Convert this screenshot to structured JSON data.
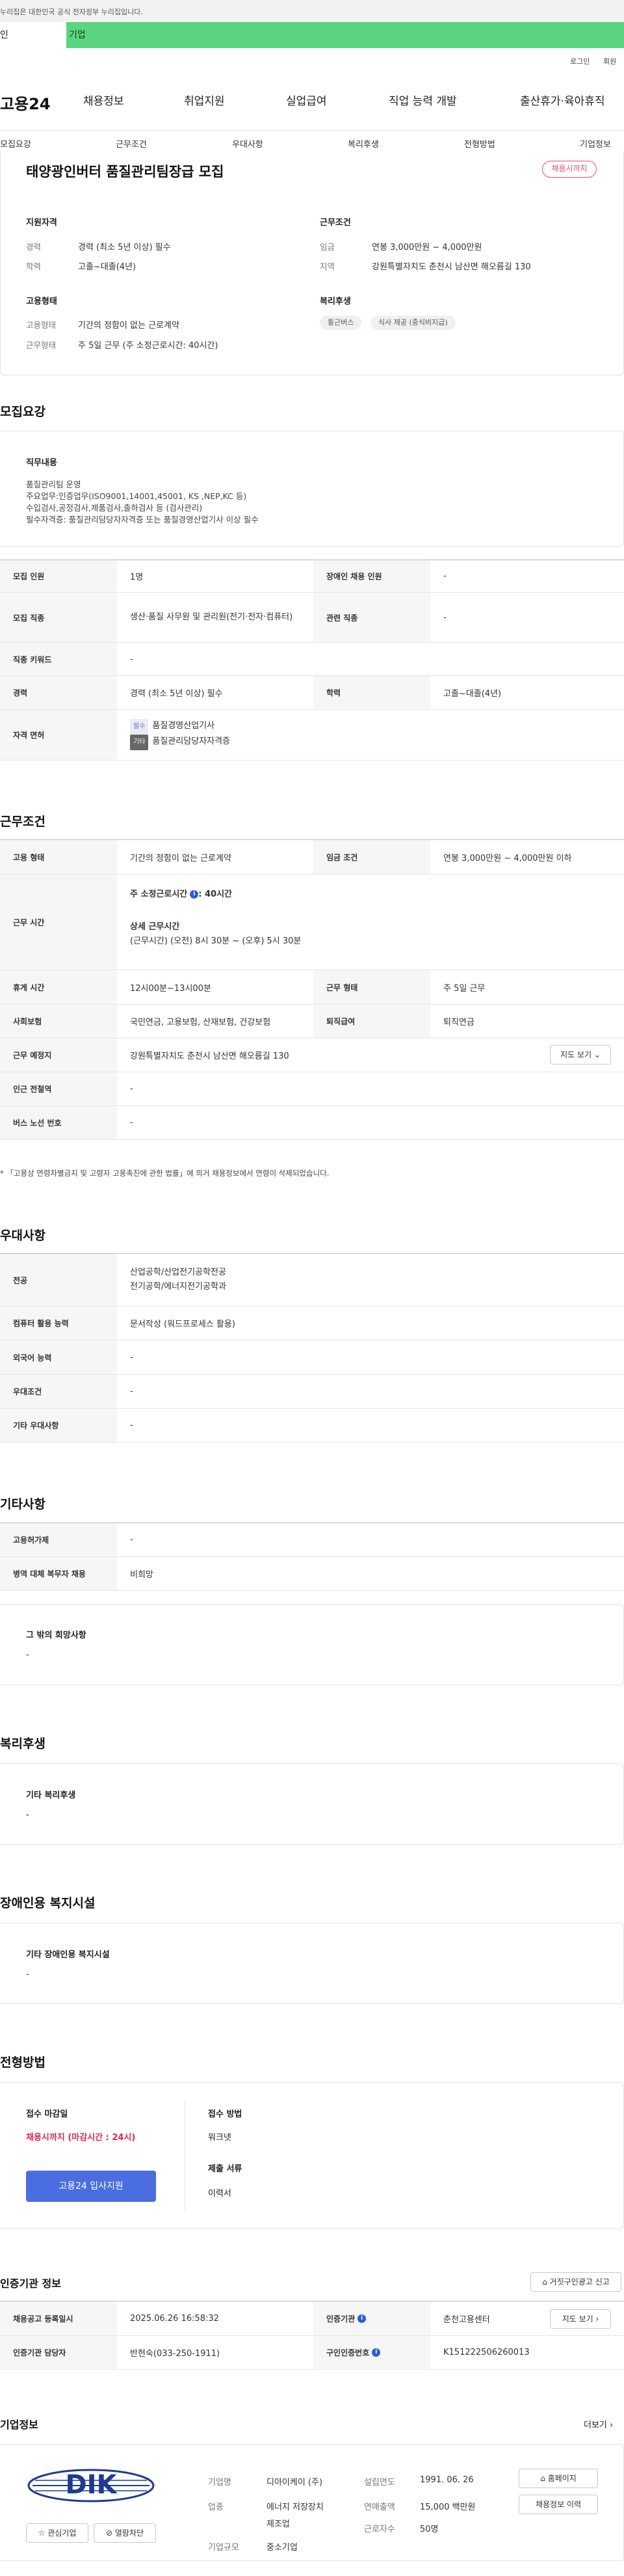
{
  "gov_notice": "누리집은 대한민국 공식 전자정부 누리집입니다.",
  "type_tabs": {
    "personal": "인",
    "company": "기업"
  },
  "util": {
    "login": "로그인",
    "signup": "회원"
  },
  "gnb": {
    "logo": "고용24",
    "items": [
      "채용정보",
      "취업지원",
      "실업급여",
      "직업 능력 개발",
      "출산휴가·육아휴직"
    ]
  },
  "subnav": [
    "모집요강",
    "근무조건",
    "우대사항",
    "복리후생",
    "전형방법",
    "기업정보"
  ],
  "summary": {
    "title": "태양광인버터 품질관리팀장급 모집",
    "status_pill": "채용시까지",
    "qual_head": "지원자격",
    "qual": [
      {
        "k": "경력",
        "v": "경력 (최소 5년 이상) 필수"
      },
      {
        "k": "학력",
        "v": "고졸~대졸(4년)"
      }
    ],
    "cond_head": "근무조건",
    "cond": [
      {
        "k": "임금",
        "v": "연봉 3,000만원 ~ 4,000만원"
      },
      {
        "k": "지역",
        "v": "강원특별자치도 춘천시 남산면 해오름길 130"
      }
    ],
    "emp_head": "고용형태",
    "emp": [
      {
        "k": "고용형태",
        "v": "기간의 정함이 없는 근로계약"
      },
      {
        "k": "근무형태",
        "v": "주 5일 근무 (주 소정근로시간: 40시간)"
      }
    ],
    "welfare_head": "복리후생",
    "welfare_tags": [
      "통근버스",
      "식사 제공 (중식비지급)"
    ]
  },
  "recruit": {
    "title": "모집요강",
    "duty_head": "직무내용",
    "duty_lines": [
      "품질관리팀 운영",
      "주요업무:인증업무(ISO9001,14001,45001, KS ,NEP,KC 등)",
      "수입검사,공정검사,제품검사,출하검사 등 (검사관리)",
      "필수자격증: 품질관리담당자자격증 또는 품질경영산업기사 이상 필수"
    ],
    "rows": {
      "count_k": "모집 인원",
      "count_v": "1명",
      "disabled_k": "장애인 채용 인원",
      "disabled_v": "-",
      "job_k": "모집 직종",
      "job_v": "생산·품질 사무원 및 관리원(전기·전자·컴퓨터)",
      "rel_k": "관련 직종",
      "rel_v": "-",
      "kw_k": "직종 키워드",
      "kw_v": "-",
      "career_k": "경력",
      "career_v": "경력 (최소 5년 이상) 필수",
      "edu_k": "학력",
      "edu_v": "고졸~대졸(4년)",
      "lic_k": "자격 면허",
      "lic_required_chip": "필수",
      "lic_required": "품질경영산업기사",
      "lic_pref_chip": "기타",
      "lic_pref": "품질관리담당자자격증"
    }
  },
  "work": {
    "title": "근무조건",
    "emp_k": "고용 형태",
    "emp_v": "기간의 정함이 없는 근로계약",
    "wage_k": "임금 조건",
    "wage_v": "연봉 3,000만원 ~ 4,000만원 이하",
    "hours_k": "근무 시간",
    "hours_total": "주 소정근로시간",
    "hours_total_v": ": 40시간",
    "hours_detail_head": "상세 근무시간",
    "hours_detail": "(근무시간) (오전) 8시 30분 ~ (오후) 5시 30분",
    "break_k": "휴게 시간",
    "break_v": "12시00분~13시00분",
    "type_k": "근무 형태",
    "type_v": "주 5일 근무",
    "ins_k": "사회보험",
    "ins_v": "국민연금, 고용보험, 산재보험, 건강보험",
    "ret_k": "퇴직급여",
    "ret_v": "퇴직연금",
    "loc_k": "근무 예정지",
    "loc_v": "강원특별자치도 춘천시 남산면 해오름길 130",
    "map_btn": "지도 보기",
    "subway_k": "인근 전철역",
    "subway_v": "-",
    "bus_k": "버스 노선 번호",
    "bus_v": "-",
    "note": "* 「고용상 연령차별금지 및 고령자 고용촉진에 관한 법률」에 의거 채용정보에서 연령이 삭제되었습니다."
  },
  "pref": {
    "title": "우대사항",
    "major_k": "전공",
    "major_v1": "산업공학/산업전기공학전공",
    "major_v2": "전기공학/에너지전기공학과",
    "pc_k": "컴퓨터 활용 능력",
    "pc_v": "문서작성 (워드프로세스 활용)",
    "lang_k": "외국어 능력",
    "lang_v": "-",
    "cond_k": "우대조건",
    "cond_v": "-",
    "etc_k": "기타 우대사항",
    "etc_v": "-"
  },
  "other": {
    "title": "기타사항",
    "ins_k": "고용허가제",
    "ins_v": "-",
    "mil_k": "병역 대체 복무자 채용",
    "mil_v": "비희망",
    "wish_head": "그 밖의 희망사항",
    "wish_v": "-"
  },
  "welfare": {
    "title": "복리후생",
    "head": "기타 복리후생",
    "v": "-"
  },
  "disabled_fac": {
    "title": "장애인용 복지시설",
    "head": "기타 장애인용 복지시설",
    "v": "-"
  },
  "selection": {
    "title": "전형방법",
    "deadline_head": "접수 마감일",
    "deadline_v": "채용시까지 (마감시간 : 24시)",
    "apply_btn": "고용24 입사지원",
    "method_head": "접수 방법",
    "method_v": "워크넷",
    "docs_head": "제출 서류",
    "docs_v": "이력서"
  },
  "agency": {
    "title": "인증기관 정보",
    "report_btn": "거짓구인광고 신고",
    "reg_k": "채용공고 등록일시",
    "reg_v": "2025.06.26 16:58:32",
    "org_k": "인증기관",
    "org_v": "춘천고용센터",
    "map_btn": "지도 보기",
    "mgr_k": "인증기관 담당자",
    "mgr_v": "반현숙(033-250-1911)",
    "no_k": "구인인증번호",
    "no_v": "K151222506260013"
  },
  "company": {
    "title": "기업정보",
    "more": "더보기",
    "logo_text": "DIK",
    "interest_btn": "관심기업",
    "block_btn": "열람차단",
    "name_k": "기업명",
    "name_v": "디아이케이 (주)",
    "est_k": "설립연도",
    "est_v": "1991. 06. 26",
    "biz_k": "업종",
    "biz_v1": "에너지 저장장치",
    "biz_v2": "제조업",
    "sales_k": "연매출액",
    "sales_v": "15,000 백만원",
    "size_k": "기업규모",
    "size_v": "중소기업",
    "emp_k": "근로자수",
    "emp_v": "50명",
    "home_btn": "홈페이지",
    "history_btn": "채용정보 이력"
  },
  "colors": {
    "accent_green": "#5bd47f",
    "pink": "#e2506b",
    "blue": "#4a6ee0",
    "red": "#e2264d"
  }
}
